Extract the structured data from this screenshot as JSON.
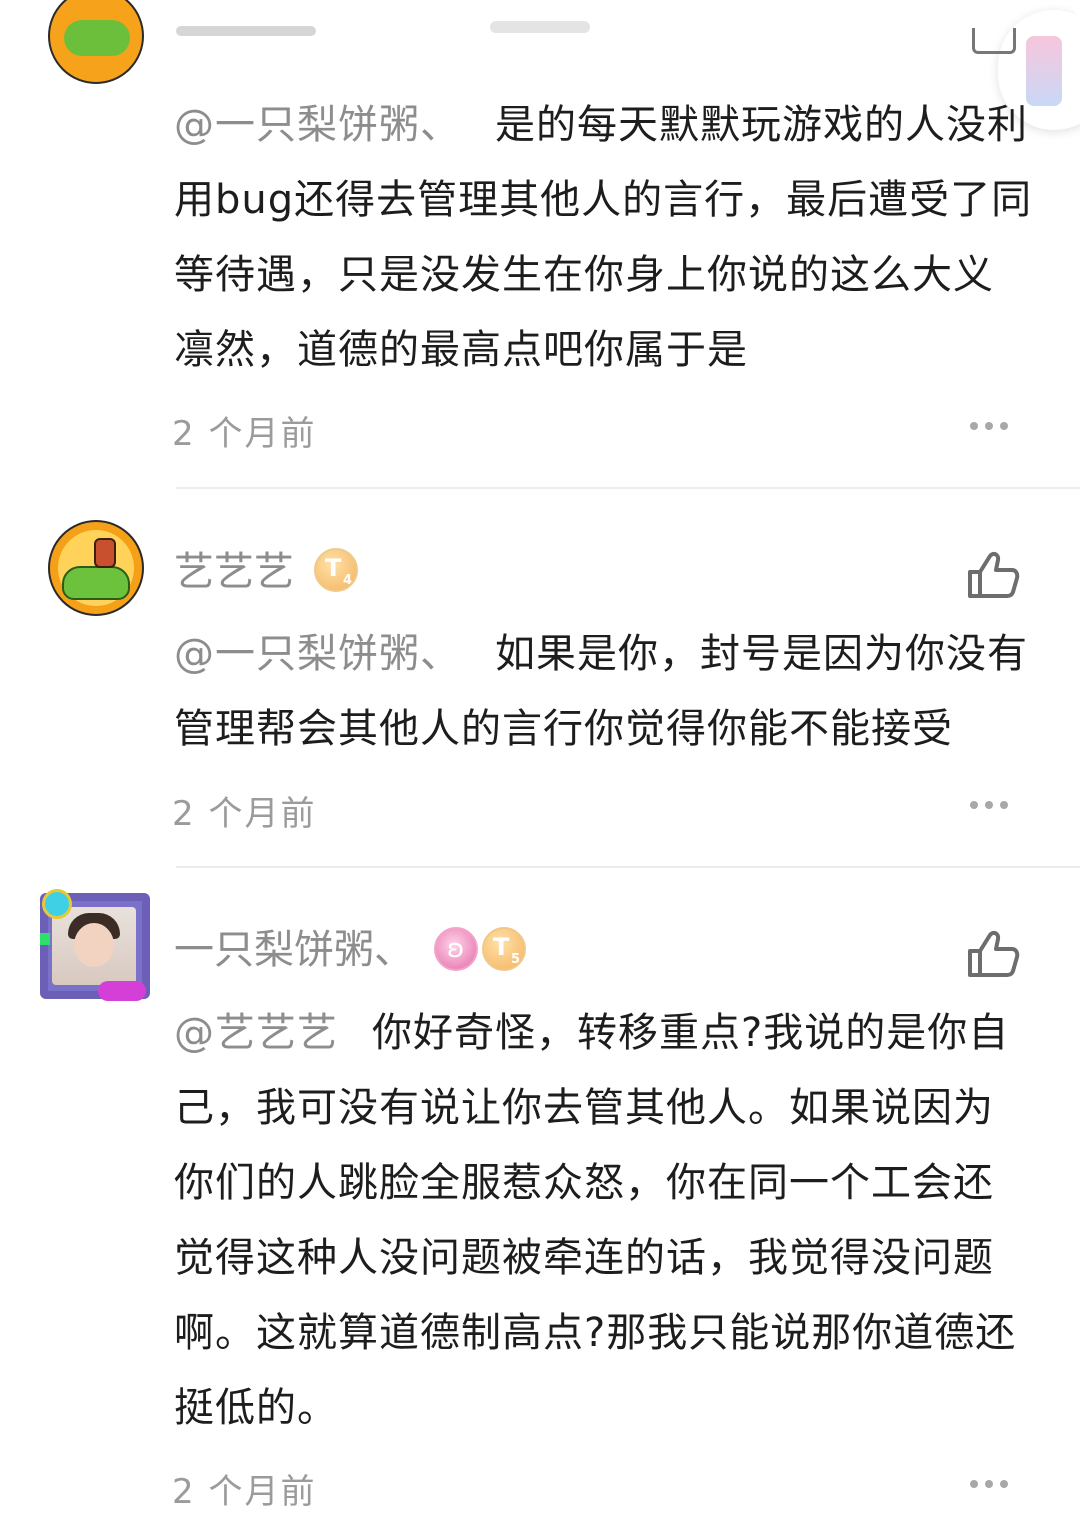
{
  "comments": [
    {
      "mention": "@一只梨饼粥、",
      "text": "是的每天默默玩游戏的人没利用bug还得去管理其他人的言行，最后遭受了同等待遇，只是没发生在你身上你说的这么大义凛然，道德的最高点吧你属于是",
      "time": "2 个月前"
    },
    {
      "username": "艺艺艺",
      "badges": [
        {
          "type": "tier",
          "letter": "T",
          "level": "4"
        }
      ],
      "mention": "@一只梨饼粥、",
      "text": "如果是你，封号是因为你没有管理帮会其他人的言行你觉得你能不能接受",
      "time": "2 个月前"
    },
    {
      "username": "一只梨饼粥、",
      "badges": [
        {
          "type": "fire"
        },
        {
          "type": "tier",
          "letter": "T",
          "level": "5"
        }
      ],
      "mention": "@艺艺艺",
      "text": "你好奇怪，转移重点?我说的是你自己，我可没有说让你去管其他人。如果说因为你们的人跳脸全服惹众怒，你在同一个工会还觉得这种人没问题被牵连的话，我觉得没问题啊。这就算道德制高点?那我只能说那你道德还挺低的。",
      "time": "2 个月前"
    }
  ],
  "icons": {
    "like": "thumbs-up-icon",
    "more": "more-dots-icon"
  },
  "colors": {
    "username": "#8d8d8d",
    "body": "#1d1d1d",
    "time": "#9b9b9b"
  }
}
